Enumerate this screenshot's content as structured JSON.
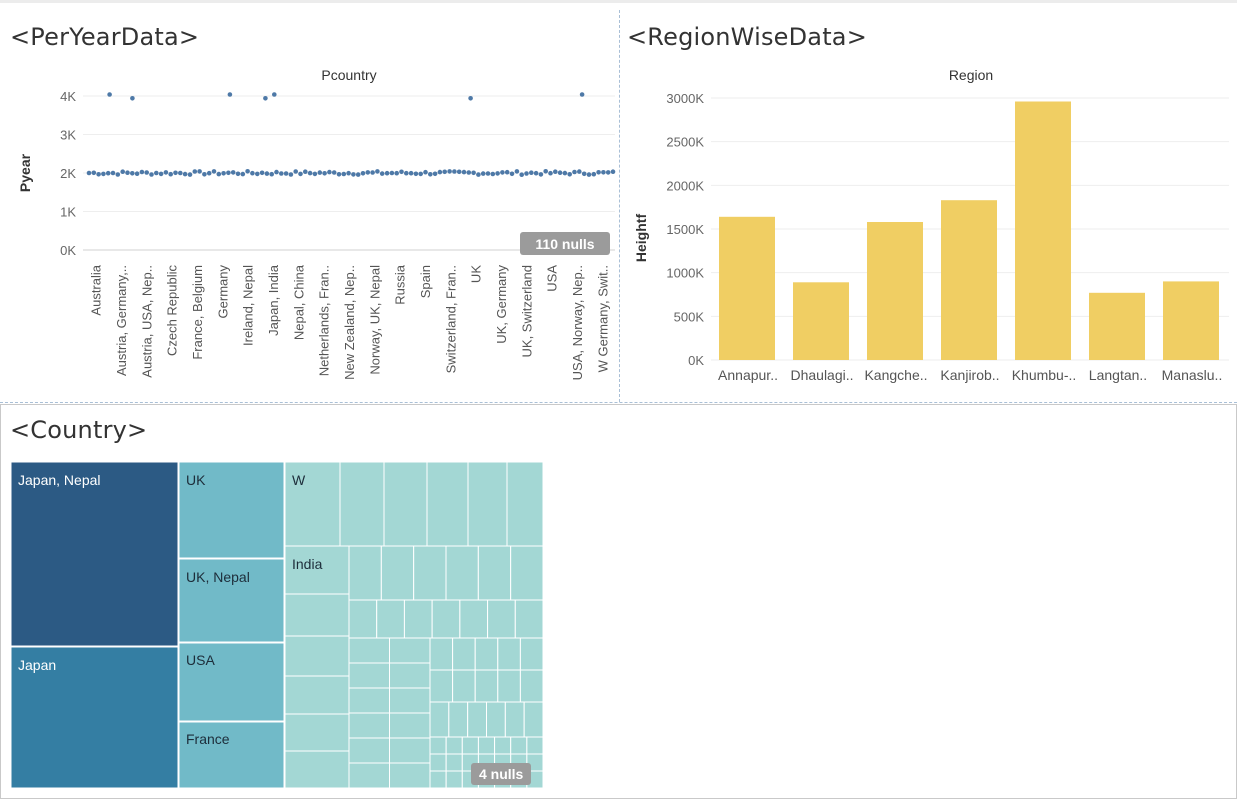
{
  "dashboard": {
    "per_year_title": "<PerYearData>",
    "region_title": "<RegionWiseData>",
    "country_title": "<Country>"
  },
  "colors": {
    "dot": "#4e79a7",
    "bar": "#f0ce63",
    "treemap_dark": "#2c5a84",
    "treemap_mid": "#347ea3",
    "treemap_light": "#71bac8",
    "treemap_pale": "#a3d7d4",
    "null_badge": "#9b9b9b"
  },
  "chart_data": [
    {
      "type": "scatter",
      "title": "Pcountry",
      "xlabel": "Pcountry",
      "ylabel": "Pyear",
      "ylim": [
        0,
        4000
      ],
      "yticks": [
        "0K",
        "1K",
        "2K",
        "3K",
        "4K"
      ],
      "categories": [
        "Australia",
        "Austria, Germany,..",
        "Austria, USA, Nep..",
        "Czech Republic",
        "France, Belgium",
        "Germany",
        "Ireland, Nepal",
        "Japan, India",
        "Nepal, China",
        "Netherlands, Fran..",
        "New Zealand, Nep..",
        "Norway, UK, Nepal",
        "Russia",
        "Spain",
        "Switzerland, Fran..",
        "UK",
        "UK, Germany",
        "UK, Switzerland",
        "USA",
        "USA, Norway, Nep..",
        "W Germany, Swit.."
      ],
      "approx_point_count": 110,
      "typical_value": 2000,
      "outlier_value": 4000,
      "grid": true,
      "nulls_label": "110 nulls"
    },
    {
      "type": "bar",
      "title": "Region",
      "xlabel": "Region",
      "ylabel": "Heightf",
      "categories": [
        "Annapur..",
        "Dhaulagi..",
        "Kangche..",
        "Kanjirob..",
        "Khumbu-..",
        "Langtan..",
        "Manaslu.."
      ],
      "values": [
        1640000,
        890000,
        1580000,
        1830000,
        2960000,
        770000,
        900000
      ],
      "ylim": [
        0,
        3000000
      ],
      "yticks": [
        "0K",
        "500K",
        "1000K",
        "1500K",
        "2000K",
        "2500K",
        "3000K"
      ],
      "grid": true
    },
    {
      "type": "treemap",
      "title": "<Country>",
      "labels": [
        "Japan, Nepal",
        "Japan",
        "UK",
        "UK, Nepal",
        "USA",
        "France",
        "W",
        "India"
      ],
      "nulls_label": "4 nulls"
    }
  ]
}
